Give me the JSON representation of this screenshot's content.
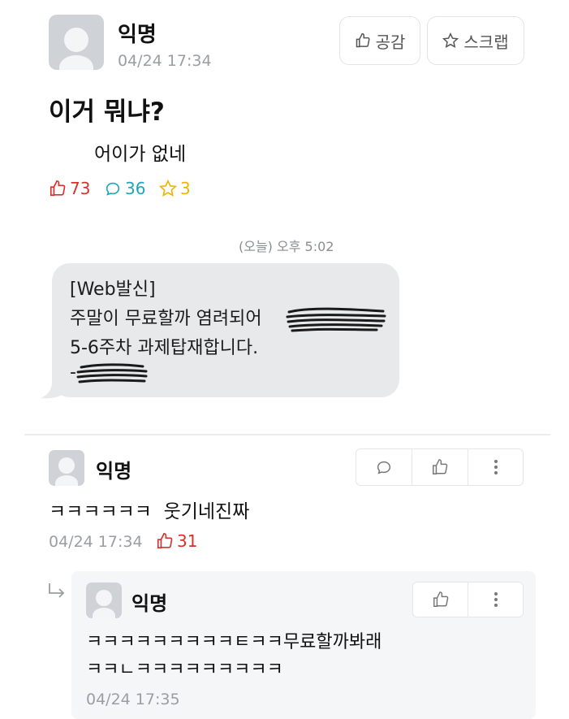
{
  "post": {
    "author": "익명",
    "timestamp": "04/24 17:34",
    "title": "이거 뭐냐?",
    "body": "어이가 없네",
    "buttons": {
      "like_label": "공감",
      "scrap_label": "스크랩"
    },
    "stats": {
      "likes": "73",
      "comments": "36",
      "scraps": "3"
    }
  },
  "message": {
    "timestamp": "(오늘) 오후 5:02",
    "lines": [
      "[Web발신]",
      "주말이 무료할까 염려되어",
      "5-6주차 과제탑재합니다.",
      "-"
    ]
  },
  "comment": {
    "author": "익명",
    "text": "ㅋㅋㅋㅋㅋㅋ  웃기네진짜",
    "timestamp": "04/24 17:34",
    "likes": "31"
  },
  "reply": {
    "author": "익명",
    "line1": "ㅋㅋㅋㅋㅋㅋㅋㅋㅋㅌㅋㅋ무료할까봐래",
    "line2": "ㅋㅋㄴㅋㅋㅋㅋㅋㅋㅋㅋㅋ",
    "timestamp": "04/24 17:35"
  },
  "colors": {
    "like": "#d6312a",
    "comment": "#1fa5b8",
    "scrap": "#f0b400",
    "muted": "#9a9ea3"
  }
}
